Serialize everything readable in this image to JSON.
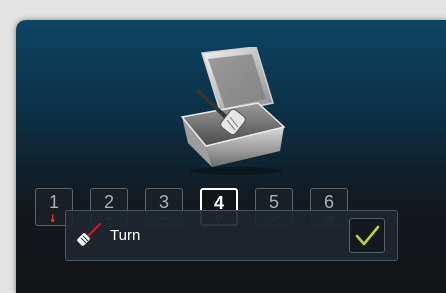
{
  "steps": [
    {
      "number": "1",
      "icon": "thermometer-icon"
    },
    {
      "number": "2",
      "icon": "tray-icon"
    },
    {
      "number": "3",
      "icon": "bowl-icon"
    },
    {
      "number": "4",
      "icon": "drop-icon",
      "active": true
    },
    {
      "number": "5",
      "icon": "lid-icon"
    },
    {
      "number": "6",
      "icon": "grill-icon"
    }
  ],
  "detail": {
    "label": "Turn",
    "icon": "spatula-icon",
    "confirm_icon": "checkmark-icon"
  },
  "illustration": {
    "icon": "fryer-basket-icon"
  },
  "colors": {
    "accent_check": "#b6d62a",
    "thermometer": "#e0312b",
    "spatula_handle": "#c8202a"
  }
}
